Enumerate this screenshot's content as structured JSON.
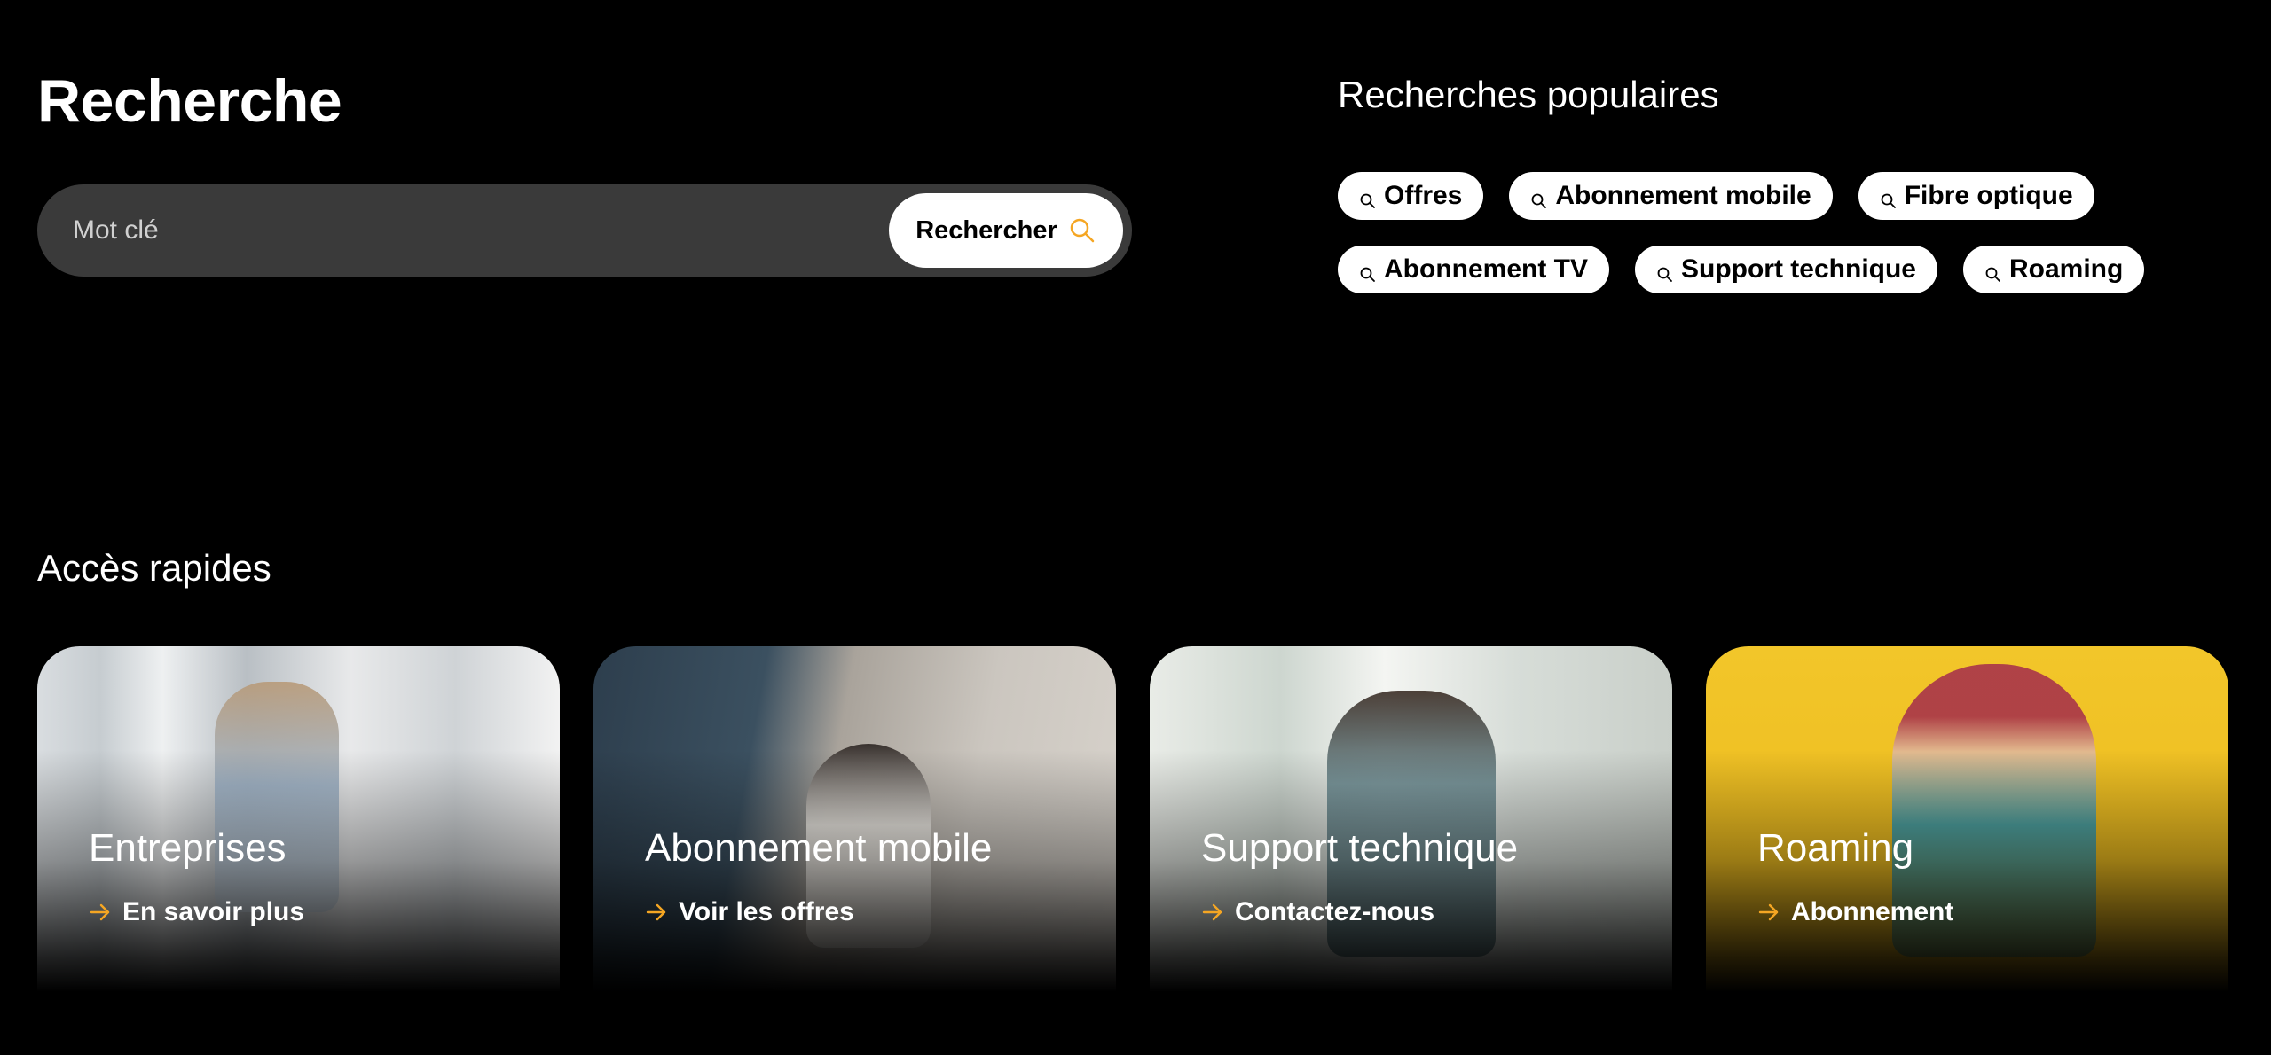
{
  "search": {
    "title": "Recherche",
    "placeholder": "Mot clé",
    "button_label": "Rechercher"
  },
  "popular": {
    "title": "Recherches populaires",
    "chips": [
      {
        "label": "Offres"
      },
      {
        "label": "Abonnement mobile"
      },
      {
        "label": "Fibre optique"
      },
      {
        "label": "Abonnement TV"
      },
      {
        "label": "Support technique"
      },
      {
        "label": "Roaming"
      }
    ]
  },
  "quick_access": {
    "title": "Accès rapides",
    "cards": [
      {
        "title": "Entreprises",
        "link": "En savoir plus"
      },
      {
        "title": "Abonnement mobile",
        "link": "Voir les offres"
      },
      {
        "title": "Support technique",
        "link": "Contactez-nous"
      },
      {
        "title": "Roaming",
        "link": "Abonnement"
      }
    ]
  },
  "colors": {
    "background": "#000000",
    "search_bar": "#3a3a3a",
    "accent": "#f5a623",
    "chip_bg": "#ffffff"
  },
  "icons": {
    "search": "search-icon",
    "chip": "search-icon",
    "link": "arrow-right-icon"
  }
}
